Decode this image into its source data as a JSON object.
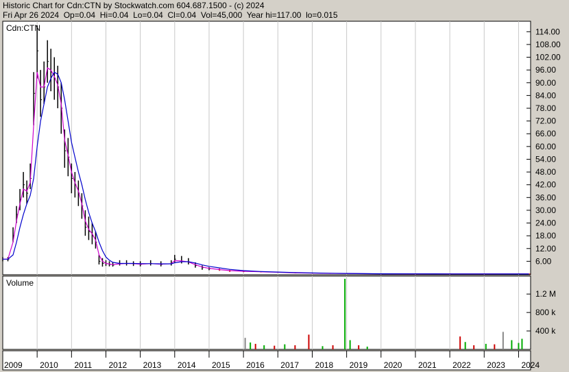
{
  "header": {
    "title_line": "Historic Chart for Cdn:CTN by Stockwatch.com 604.687.1500 - (c) 2024",
    "quote_line": "Fri Apr 26 2024  Op=0.04  Hi=0.04  Lo=0.04  Cl=0.04  Vol=45,000  Year hi=117.00  lo=0.015"
  },
  "price_panel": {
    "label": "Cdn:CTN"
  },
  "volume_panel": {
    "label": "Volume"
  },
  "colors": {
    "background": "#ffffff",
    "frame": "#d4d0c8",
    "candle": "#000000",
    "ma_short": "#cc00cc",
    "ma_long": "#0000cc",
    "price_tail": "#cc0000",
    "volume_up": "#00aa00",
    "volume_down": "#cc0000",
    "volume_flat": "#888888",
    "grid": "#c8c8c8"
  },
  "chart_data": [
    {
      "type": "line",
      "panel": "price",
      "title": "Cdn:CTN",
      "xlim": [
        2009,
        2024.35
      ],
      "ylim": [
        0,
        117
      ],
      "y_ticks": [
        "114.00",
        "108.00",
        "102.00",
        "96.00",
        "90.00",
        "84.00",
        "78.00",
        "72.00",
        "66.00",
        "60.00",
        "54.00",
        "48.00",
        "42.00",
        "36.00",
        "30.00",
        "24.00",
        "18.00",
        "12.00",
        "6.00"
      ],
      "x_ticks": [
        "2009",
        "2010",
        "2011",
        "2012",
        "2013",
        "2014",
        "2015",
        "2016",
        "2017",
        "2018",
        "2019",
        "2020",
        "2021",
        "2022",
        "2023",
        "2024"
      ],
      "grid": true,
      "series": [
        {
          "kind": "close",
          "x": [
            2009.0,
            2009.15,
            2009.3,
            2009.4,
            2009.5,
            2009.6,
            2009.7,
            2009.8,
            2009.9,
            2010.0,
            2010.1,
            2010.2,
            2010.3,
            2010.4,
            2010.5,
            2010.6,
            2010.7,
            2010.8,
            2010.9,
            2011.0,
            2011.1,
            2011.2,
            2011.3,
            2011.4,
            2011.5,
            2011.6,
            2011.7,
            2011.8,
            2011.9,
            2012.0,
            2012.1,
            2012.2,
            2012.4,
            2012.6,
            2012.8,
            2013.0,
            2013.3,
            2013.6,
            2013.9,
            2014.0,
            2014.2,
            2014.4,
            2014.6,
            2014.8,
            2015.0,
            2015.3,
            2015.6,
            2016.0,
            2016.5,
            2017.0,
            2017.5,
            2018.0,
            2018.5,
            2019.0,
            2019.5,
            2020.0,
            2021.0,
            2022.0,
            2023.0,
            2024.0,
            2024.3
          ],
          "values": [
            7,
            7,
            18,
            28,
            35,
            42,
            38,
            45,
            85,
            105,
            82,
            88,
            100,
            95,
            92,
            88,
            78,
            58,
            55,
            45,
            42,
            38,
            32,
            22,
            20,
            18,
            15,
            6,
            5,
            5,
            4.5,
            4.2,
            5,
            5,
            4.8,
            4.5,
            5,
            4.5,
            5,
            7,
            6,
            5.5,
            4,
            3,
            2.5,
            2,
            1.5,
            1.2,
            1,
            0.8,
            0.5,
            0.4,
            0.3,
            0.2,
            0.15,
            0.1,
            0.06,
            0.05,
            0.04,
            0.04,
            0.04
          ]
        },
        {
          "kind": "high",
          "values": [
            8,
            8,
            22,
            32,
            40,
            48,
            44,
            52,
            95,
            117,
            96,
            100,
            110,
            106,
            102,
            98,
            90,
            68,
            64,
            52,
            48,
            44,
            38,
            30,
            27,
            24,
            20,
            9,
            7.5,
            6.5,
            6,
            5.5,
            6.5,
            6.5,
            6,
            6,
            6.5,
            6,
            6.5,
            9,
            8.5,
            7.5,
            5.5,
            4,
            3.2,
            2.6,
            2,
            1.6,
            1.3,
            1,
            0.7,
            0.5,
            0.4,
            0.3,
            0.2,
            0.14,
            0.08,
            0.07,
            0.05,
            0.05,
            0.05
          ]
        },
        {
          "kind": "low",
          "values": [
            6,
            6,
            15,
            24,
            30,
            36,
            33,
            40,
            70,
            92,
            74,
            80,
            90,
            86,
            82,
            78,
            66,
            50,
            46,
            38,
            36,
            32,
            26,
            18,
            16,
            14,
            12,
            4.5,
            3.5,
            3.8,
            3.6,
            3.5,
            4,
            4,
            3.8,
            3.6,
            4,
            3.6,
            4,
            5.5,
            5,
            4.5,
            3,
            2,
            1.8,
            1.5,
            1,
            0.9,
            0.8,
            0.6,
            0.35,
            0.3,
            0.2,
            0.15,
            0.1,
            0.07,
            0.04,
            0.03,
            0.02,
            0.02,
            0.03
          ]
        },
        {
          "kind": "ma_short",
          "values": [
            7,
            7,
            15,
            25,
            33,
            40,
            39,
            43,
            70,
            95,
            88,
            88,
            97,
            96,
            93,
            89,
            80,
            63,
            56,
            48,
            43,
            39,
            33,
            25,
            21,
            19,
            16,
            9,
            6,
            5,
            4.7,
            4.4,
            4.8,
            5,
            4.9,
            4.6,
            4.9,
            4.6,
            4.9,
            6.3,
            6.2,
            5.7,
            4.4,
            3.3,
            2.7,
            2.1,
            1.6,
            1.3,
            1.05,
            0.85,
            0.55,
            0.42,
            0.32,
            0.22,
            0.16,
            0.11,
            0.07,
            0.05,
            0.045,
            0.04,
            0.04
          ]
        },
        {
          "kind": "ma_long",
          "values": [
            7,
            7,
            9,
            15,
            22,
            28,
            33,
            37,
            45,
            60,
            72,
            80,
            88,
            92,
            95,
            94,
            90,
            82,
            72,
            62,
            55,
            48,
            42,
            35,
            29,
            24,
            20,
            15,
            11,
            8,
            6.5,
            5.5,
            5,
            5,
            5,
            4.9,
            4.9,
            4.8,
            4.8,
            5.3,
            5.8,
            5.8,
            5.2,
            4.3,
            3.6,
            2.9,
            2.2,
            1.6,
            1.2,
            0.95,
            0.7,
            0.5,
            0.38,
            0.28,
            0.2,
            0.14,
            0.09,
            0.06,
            0.05,
            0.045,
            0.045
          ]
        }
      ]
    },
    {
      "type": "bar",
      "panel": "volume",
      "title": "Volume",
      "ylim": [
        0,
        1500000
      ],
      "y_ticks": [
        "1.2 M",
        "800 k",
        "400 k"
      ],
      "y_tick_values": [
        1200000,
        800000,
        400000
      ],
      "bars": [
        {
          "x": 2016.05,
          "value": 250000,
          "color": "volume_flat"
        },
        {
          "x": 2016.2,
          "value": 150000,
          "color": "volume_up"
        },
        {
          "x": 2016.35,
          "value": 120000,
          "color": "volume_down"
        },
        {
          "x": 2016.6,
          "value": 90000,
          "color": "volume_up"
        },
        {
          "x": 2016.9,
          "value": 80000,
          "color": "volume_down"
        },
        {
          "x": 2017.2,
          "value": 110000,
          "color": "volume_up"
        },
        {
          "x": 2017.5,
          "value": 90000,
          "color": "volume_down"
        },
        {
          "x": 2017.9,
          "value": 320000,
          "color": "volume_down"
        },
        {
          "x": 2018.3,
          "value": 70000,
          "color": "volume_up"
        },
        {
          "x": 2018.6,
          "value": 90000,
          "color": "volume_down"
        },
        {
          "x": 2018.95,
          "value": 1530000,
          "color": "volume_up"
        },
        {
          "x": 2019.1,
          "value": 200000,
          "color": "volume_up"
        },
        {
          "x": 2019.35,
          "value": 90000,
          "color": "volume_down"
        },
        {
          "x": 2019.6,
          "value": 60000,
          "color": "volume_up"
        },
        {
          "x": 2022.3,
          "value": 280000,
          "color": "volume_down"
        },
        {
          "x": 2022.45,
          "value": 160000,
          "color": "volume_up"
        },
        {
          "x": 2022.7,
          "value": 90000,
          "color": "volume_down"
        },
        {
          "x": 2023.05,
          "value": 120000,
          "color": "volume_up"
        },
        {
          "x": 2023.3,
          "value": 110000,
          "color": "volume_down"
        },
        {
          "x": 2023.55,
          "value": 380000,
          "color": "volume_flat"
        },
        {
          "x": 2023.8,
          "value": 200000,
          "color": "volume_up"
        },
        {
          "x": 2024.0,
          "value": 140000,
          "color": "volume_up"
        },
        {
          "x": 2024.1,
          "value": 230000,
          "color": "volume_up"
        }
      ]
    }
  ]
}
